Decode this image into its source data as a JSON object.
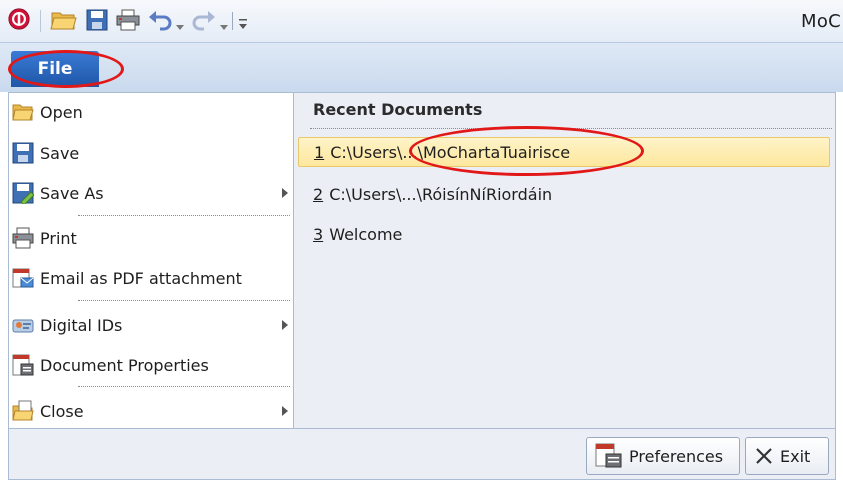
{
  "window": {
    "title": "MoC"
  },
  "quick_access": {
    "icons": [
      "app-logo-icon",
      "open-folder-icon",
      "save-icon",
      "print-icon",
      "undo-icon",
      "undo-dropdown-icon",
      "redo-icon",
      "redo-dropdown-icon",
      "customize-toolbar-icon"
    ]
  },
  "file_tab": {
    "label": "File"
  },
  "menu": {
    "items": [
      {
        "label": "Open",
        "icon": "open-folder-icon"
      },
      {
        "label": "Save",
        "icon": "save-icon"
      },
      {
        "label": "Save As",
        "icon": "save-as-icon",
        "submenu": true
      },
      {
        "label": "Print",
        "icon": "print-icon"
      },
      {
        "label": "Email as PDF attachment",
        "icon": "email-pdf-icon"
      },
      {
        "label": "Digital IDs",
        "icon": "digital-ids-icon",
        "submenu": true
      },
      {
        "label": "Document Properties",
        "icon": "document-properties-icon"
      },
      {
        "label": "Close",
        "icon": "close-document-icon",
        "submenu": true
      }
    ]
  },
  "recent": {
    "title": "Recent Documents",
    "items": [
      {
        "num": "1",
        "path": "C:\\Users\\...\\MoChartaTuairisce",
        "selected": true
      },
      {
        "num": "2",
        "path": "C:\\Users\\...\\RóisínNíRiordáin",
        "selected": false
      },
      {
        "num": "3",
        "path": "Welcome",
        "selected": false
      }
    ]
  },
  "footer": {
    "preferences_label": "Preferences",
    "exit_label": "Exit"
  },
  "colors": {
    "file_tab": "#2a67c0",
    "highlight": "#fde89e",
    "annotation_ring": "#e21717"
  }
}
